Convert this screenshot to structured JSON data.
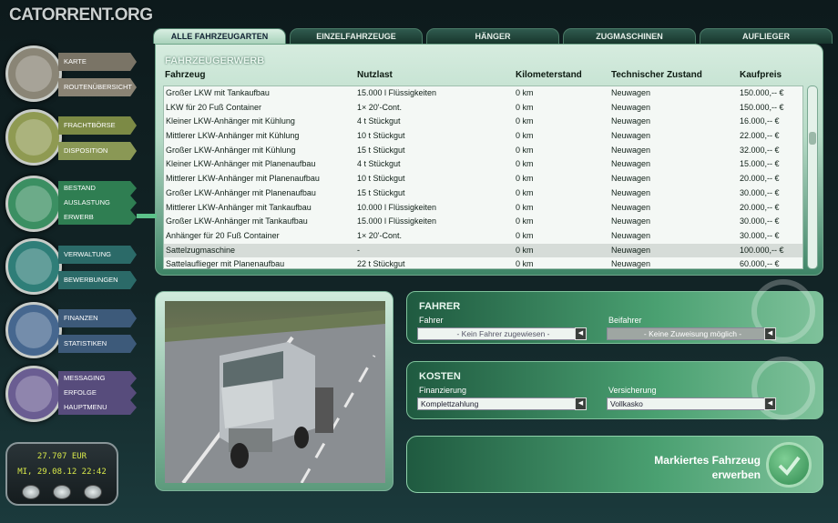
{
  "logo": "CATORRENT.ORG",
  "tabs": [
    "ALLE FAHRZEUGARTEN",
    "EINZELFAHRZEUGE",
    "HÄNGER",
    "ZUGMASCHINEN",
    "AUFLIEGER"
  ],
  "nav": [
    {
      "items": [
        "KARTE",
        "ROUTENÜBERSICHT"
      ],
      "colors": [
        "#7a7466",
        "#8a8374"
      ]
    },
    {
      "items": [
        "FRACHTBÖRSE",
        "DISPOSITION"
      ],
      "colors": [
        "#7c8a45",
        "#8a9855"
      ]
    },
    {
      "items": [
        "BESTAND",
        "AUSLASTUNG",
        "ERWERB"
      ],
      "colors": [
        "#2f7e52",
        "#2f7e52",
        "#2f7e52"
      ]
    },
    {
      "items": [
        "VERWALTUNG",
        "BEWERBUNGEN"
      ],
      "colors": [
        "#2b6a68",
        "#2b6a68"
      ]
    },
    {
      "items": [
        "FINANZEN",
        "STATISTIKEN"
      ],
      "colors": [
        "#3d5a7a",
        "#3d5a7a"
      ]
    },
    {
      "items": [
        "MESSAGING",
        "ERFOLGE",
        "HAUPTMENU"
      ],
      "colors": [
        "#574c7c",
        "#574c7c",
        "#574c7c"
      ]
    }
  ],
  "panel": {
    "title": "FAHRZEUGERWERB",
    "headers": [
      "Fahrzeug",
      "Nutzlast",
      "Kilometerstand",
      "Technischer Zustand",
      "Kaufpreis"
    ],
    "rows": [
      [
        "Großer LKW mit Tankaufbau",
        "15.000 l Flüssigkeiten",
        "0 km",
        "Neuwagen",
        "150.000,-- €"
      ],
      [
        "LKW für 20 Fuß Container",
        "1× 20'-Cont.",
        "0 km",
        "Neuwagen",
        "150.000,-- €"
      ],
      [
        "Kleiner LKW-Anhänger mit Kühlung",
        "4 t Stückgut",
        "0 km",
        "Neuwagen",
        "16.000,-- €"
      ],
      [
        "Mittlerer LKW-Anhänger mit Kühlung",
        "10 t Stückgut",
        "0 km",
        "Neuwagen",
        "22.000,-- €"
      ],
      [
        "Großer LKW-Anhänger mit Kühlung",
        "15 t Stückgut",
        "0 km",
        "Neuwagen",
        "32.000,-- €"
      ],
      [
        "Kleiner LKW-Anhänger mit Planenaufbau",
        "4 t Stückgut",
        "0 km",
        "Neuwagen",
        "15.000,-- €"
      ],
      [
        "Mittlerer LKW-Anhänger mit Planenaufbau",
        "10 t Stückgut",
        "0 km",
        "Neuwagen",
        "20.000,-- €"
      ],
      [
        "Großer LKW-Anhänger mit Planenaufbau",
        "15 t Stückgut",
        "0 km",
        "Neuwagen",
        "30.000,-- €"
      ],
      [
        "Mittlerer LKW-Anhänger mit Tankaufbau",
        "10.000 l Flüssigkeiten",
        "0 km",
        "Neuwagen",
        "20.000,-- €"
      ],
      [
        "Großer LKW-Anhänger mit Tankaufbau",
        "15.000 l Flüssigkeiten",
        "0 km",
        "Neuwagen",
        "30.000,-- €"
      ],
      [
        "Anhänger für 20 Fuß Container",
        "1× 20'-Cont.",
        "0 km",
        "Neuwagen",
        "30.000,-- €"
      ],
      [
        "Sattelzugmaschine",
        "-",
        "0 km",
        "Neuwagen",
        "100.000,-- €"
      ],
      [
        "Sattelauflieger mit Planenaufbau",
        "22 t Stückgut",
        "0 km",
        "Neuwagen",
        "60.000,-- €"
      ]
    ],
    "selected_row": 11
  },
  "fahrer": {
    "title": "FAHRER",
    "fahrer_label": "Fahrer",
    "fahrer_value": "- Kein Fahrer zugewiesen -",
    "beifahrer_label": "Beifahrer",
    "beifahrer_value": "- Keine Zuweisung möglich -"
  },
  "kosten": {
    "title": "KOSTEN",
    "fin_label": "Finanzierung",
    "fin_value": "Komplettzahlung",
    "vers_label": "Versicherung",
    "vers_value": "Vollkasko"
  },
  "buy": {
    "line1": "Markiertes Fahrzeug",
    "line2": "erwerben"
  },
  "status": {
    "money": "27.707 EUR",
    "clock": "MI, 29.08.12  22:42"
  }
}
